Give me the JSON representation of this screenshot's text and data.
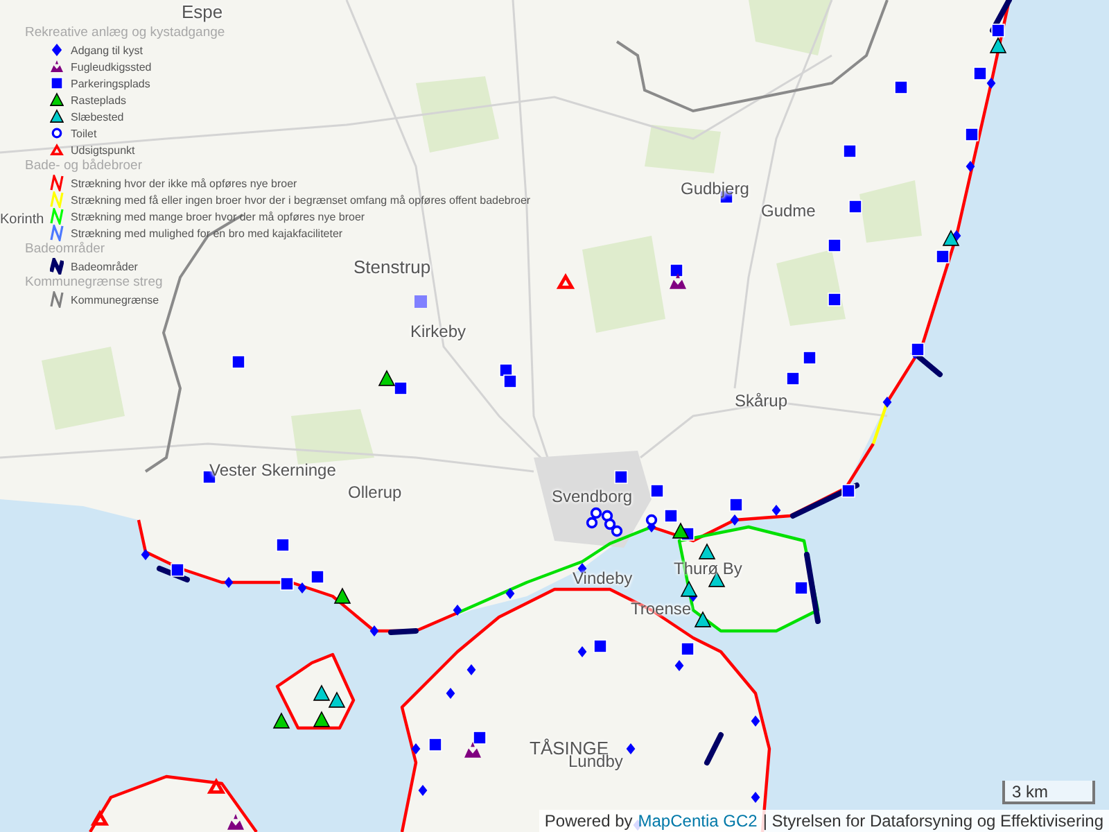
{
  "legend": {
    "groups": [
      {
        "title": "Rekreative anlæg og kystadgange",
        "items": [
          {
            "kind": "diamond",
            "color": "#0000ff",
            "label": "Adgang til kyst"
          },
          {
            "kind": "bird",
            "color": "#800080",
            "label": "Fugleudkigssted"
          },
          {
            "kind": "square",
            "color": "#0000ff",
            "label": "Parkeringsplads"
          },
          {
            "kind": "triangle",
            "color": "#00cc00",
            "label": "Rasteplads"
          },
          {
            "kind": "triangle",
            "color": "#00cccc",
            "label": "Slæbested"
          },
          {
            "kind": "ring",
            "color": "#0000ff",
            "label": "Toilet"
          },
          {
            "kind": "view",
            "color": "#ff0000",
            "label": "Udsigtspunkt"
          }
        ]
      },
      {
        "title": "Bade- og bådebroer",
        "items": [
          {
            "kind": "line",
            "color": "#ff0000",
            "label": "Strækning hvor der ikke må opføres nye broer"
          },
          {
            "kind": "line",
            "color": "#ffff00",
            "label": "Strækning med få eller ingen broer hvor der i begrænset omfang må opføres offent badebroer"
          },
          {
            "kind": "line",
            "color": "#00ff00",
            "label": "Strækning med mange broer hvor der må opføres nye broer"
          },
          {
            "kind": "line",
            "color": "#4d79ff",
            "label": "Strækning med mulighed for en bro med kajakfaciliteter"
          }
        ]
      },
      {
        "title": "Badeområder",
        "items": [
          {
            "kind": "thick",
            "color": "#000066",
            "label": "Badeområder"
          }
        ]
      },
      {
        "title": "Kommunegrænse streg",
        "items": [
          {
            "kind": "line",
            "color": "#808080",
            "label": "Kommunegrænse"
          }
        ]
      }
    ]
  },
  "places": [
    {
      "name": "Espe"
    },
    {
      "name": "Korinth"
    },
    {
      "name": "Stenstrup"
    },
    {
      "name": "Kirkeby"
    },
    {
      "name": "Gudbjerg"
    },
    {
      "name": "Gudme"
    },
    {
      "name": "Skårup"
    },
    {
      "name": "Vester Skerninge"
    },
    {
      "name": "Ollerup"
    },
    {
      "name": "Svendborg"
    },
    {
      "name": "Vindeby"
    },
    {
      "name": "Thurø By"
    },
    {
      "name": "Troense"
    },
    {
      "name": "TÅSINGE"
    },
    {
      "name": "Lundby"
    }
  ],
  "scale": {
    "label": "3 km"
  },
  "attribution": {
    "prefix": "Powered by",
    "link": "MapCentia GC2",
    "suffix": "| Styrelsen for Dataforsyning og Effektivisering"
  }
}
